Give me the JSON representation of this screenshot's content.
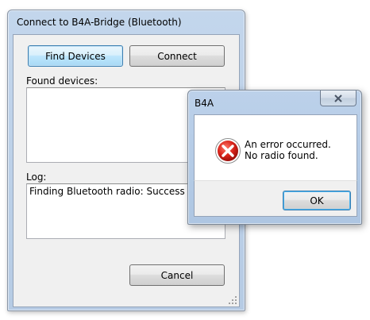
{
  "main_window": {
    "title": "Connect to B4A-Bridge (Bluetooth)",
    "find_devices_button": "Find Devices",
    "connect_button": "Connect",
    "found_devices_label": "Found devices:",
    "found_devices": [],
    "log_label": "Log:",
    "log_lines": [
      "Finding Bluetooth radio: Success"
    ],
    "cancel_button": "Cancel"
  },
  "dialog": {
    "title": "B4A",
    "message_line1": "An error occurred.",
    "message_line2": "No radio found.",
    "ok_button": "OK",
    "icon": "error-icon",
    "close_icon": "close-icon"
  }
}
